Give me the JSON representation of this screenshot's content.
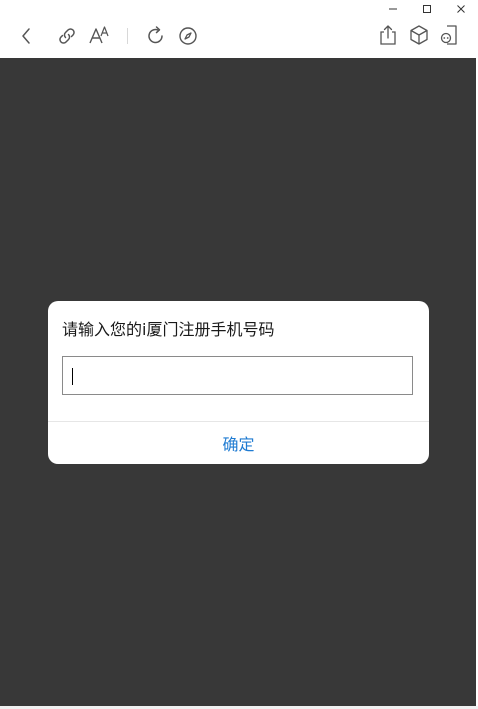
{
  "window": {
    "controls": {
      "minimize_icon": "minimize-icon",
      "maximize_icon": "maximize-icon",
      "close_icon": "close-icon"
    }
  },
  "toolbar": {
    "icons": [
      "back-arrow-icon",
      "link-icon",
      "font-size-icon",
      "refresh-icon",
      "compass-icon",
      "share-icon",
      "cube-icon",
      "mini-program-icon"
    ],
    "icon_color": "#555555"
  },
  "content": {
    "background_color": "#383838"
  },
  "dialog": {
    "title": "请输入您的i厦门注册手机号码",
    "input_value": "",
    "confirm_label": "确定",
    "confirm_color": "#1f7bd2"
  }
}
